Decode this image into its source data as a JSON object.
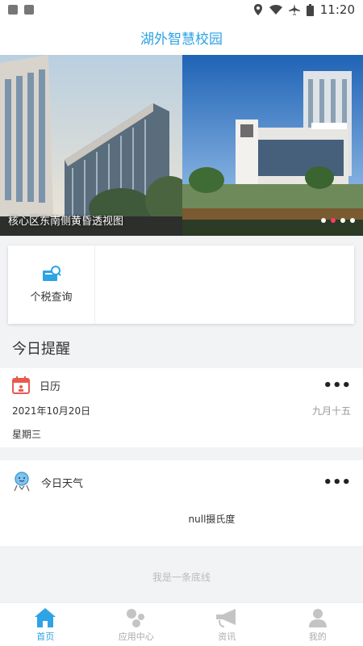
{
  "status": {
    "time": "11:20"
  },
  "app": {
    "title": "湖外智慧校园"
  },
  "banner": {
    "caption": "核心区东南侧黄昏透视图",
    "dots": 4,
    "active_dot": 1
  },
  "quick_entries": [
    {
      "label": "个税查询",
      "icon": "tax-icon"
    }
  ],
  "section": {
    "title": "今日提醒"
  },
  "calendar": {
    "title": "日历",
    "date": "2021年10月20日",
    "lunar": "九月十五",
    "weekday": "星期三",
    "more": "•••"
  },
  "weather": {
    "title": "今日天气",
    "temperature": "null摄氏度",
    "more": "•••"
  },
  "footer": {
    "text": "我是一条底线"
  },
  "tabs": [
    {
      "label": "首页",
      "icon": "home-icon",
      "active": true
    },
    {
      "label": "应用中心",
      "icon": "apps-icon",
      "active": false
    },
    {
      "label": "资讯",
      "icon": "megaphone-icon",
      "active": false
    },
    {
      "label": "我的",
      "icon": "user-icon",
      "active": false
    }
  ],
  "colors": {
    "accent": "#2ea3e6",
    "dot_active": "#ff3b6b"
  }
}
